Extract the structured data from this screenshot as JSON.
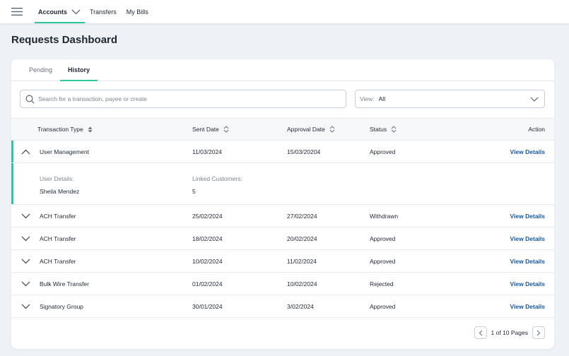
{
  "topnav": {
    "items": [
      {
        "label": "Accounts",
        "active": true
      },
      {
        "label": "Transfers",
        "active": false
      },
      {
        "label": "My Bills",
        "active": false
      }
    ]
  },
  "page": {
    "title": "Requests Dashboard"
  },
  "tabs": [
    {
      "label": "Pending",
      "active": false
    },
    {
      "label": "History",
      "active": true
    }
  ],
  "search": {
    "placeholder": "Search for a transaction, payee or create",
    "value": ""
  },
  "view": {
    "label": "View:",
    "value": "All"
  },
  "table": {
    "headers": {
      "type": "Transaction Type",
      "sent": "Sent Date",
      "approval": "Approval Date",
      "status": "Status",
      "action": "Action"
    },
    "rows": [
      {
        "type": "User Management",
        "sent": "11/03/2024",
        "approval": "15/03/20204",
        "status": "Approved",
        "action": "View Details",
        "expanded": true
      },
      {
        "type": "ACH Transfer",
        "sent": "25/02/2024",
        "approval": "27/02/2024",
        "status": "Withdrawn",
        "action": "View Details",
        "expanded": false
      },
      {
        "type": "ACH Transfer",
        "sent": "18/02/2024",
        "approval": "20/02/2024",
        "status": "Approved",
        "action": "View Details",
        "expanded": false
      },
      {
        "type": "ACH Transfer",
        "sent": "10/02/2024",
        "approval": "11/02/2024",
        "status": "Approved",
        "action": "View Details",
        "expanded": false
      },
      {
        "type": "Bulk Wire Transfer",
        "sent": "01/02/2024",
        "approval": "10/02/2024",
        "status": "Rejected",
        "action": "View Details",
        "expanded": false
      },
      {
        "type": "Signatory Group",
        "sent": "30/01/2024",
        "approval": "3/02/2024",
        "status": "Approved",
        "action": "View Details",
        "expanded": false
      }
    ],
    "detail": {
      "user_label": "User Details:",
      "user_value": "Sheila Mendez",
      "linked_label": "Linked Customers:",
      "linked_value": "5"
    }
  },
  "pagination": {
    "text": "1 of 10 Pages"
  },
  "colors": {
    "accent": "#2fc6a0",
    "link": "#1557a8"
  },
  "icons": [
    "menu-icon",
    "chevron-down-icon",
    "search-icon",
    "sort-icon",
    "chevron-up-icon",
    "chevron-left-icon",
    "chevron-right-icon"
  ]
}
